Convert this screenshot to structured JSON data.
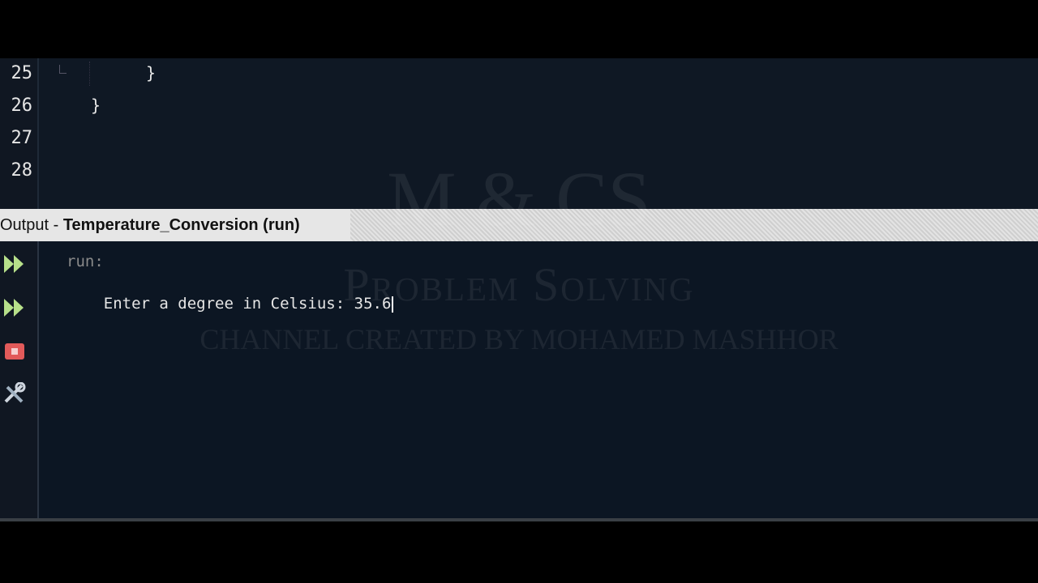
{
  "editor": {
    "lines": [
      {
        "num": "25",
        "code": "}"
      },
      {
        "num": "26",
        "code": "}"
      },
      {
        "num": "27",
        "code": ""
      },
      {
        "num": "28",
        "code": ""
      }
    ]
  },
  "output": {
    "title_prefix": "Output - ",
    "title_name": "Temperature_Conversion (run)",
    "run_label": "run:",
    "prompt": "Enter a degree in Celsius: ",
    "input_value": "35.6"
  },
  "toolbar": {
    "icons": [
      "rerun-icon",
      "rerun-with-args-icon",
      "stop-icon",
      "settings-icon"
    ]
  },
  "watermark": {
    "line1": "M & CS",
    "line2": "Problem Solving",
    "line3": "CHANNEL CREATED BY MOHAMED MASHHOR"
  },
  "colors": {
    "background": "#000000",
    "editor_bg": "#0f1824",
    "output_bg": "#0c1623",
    "run_icon": "#b7e08a",
    "stop_icon": "#e25a5a"
  }
}
